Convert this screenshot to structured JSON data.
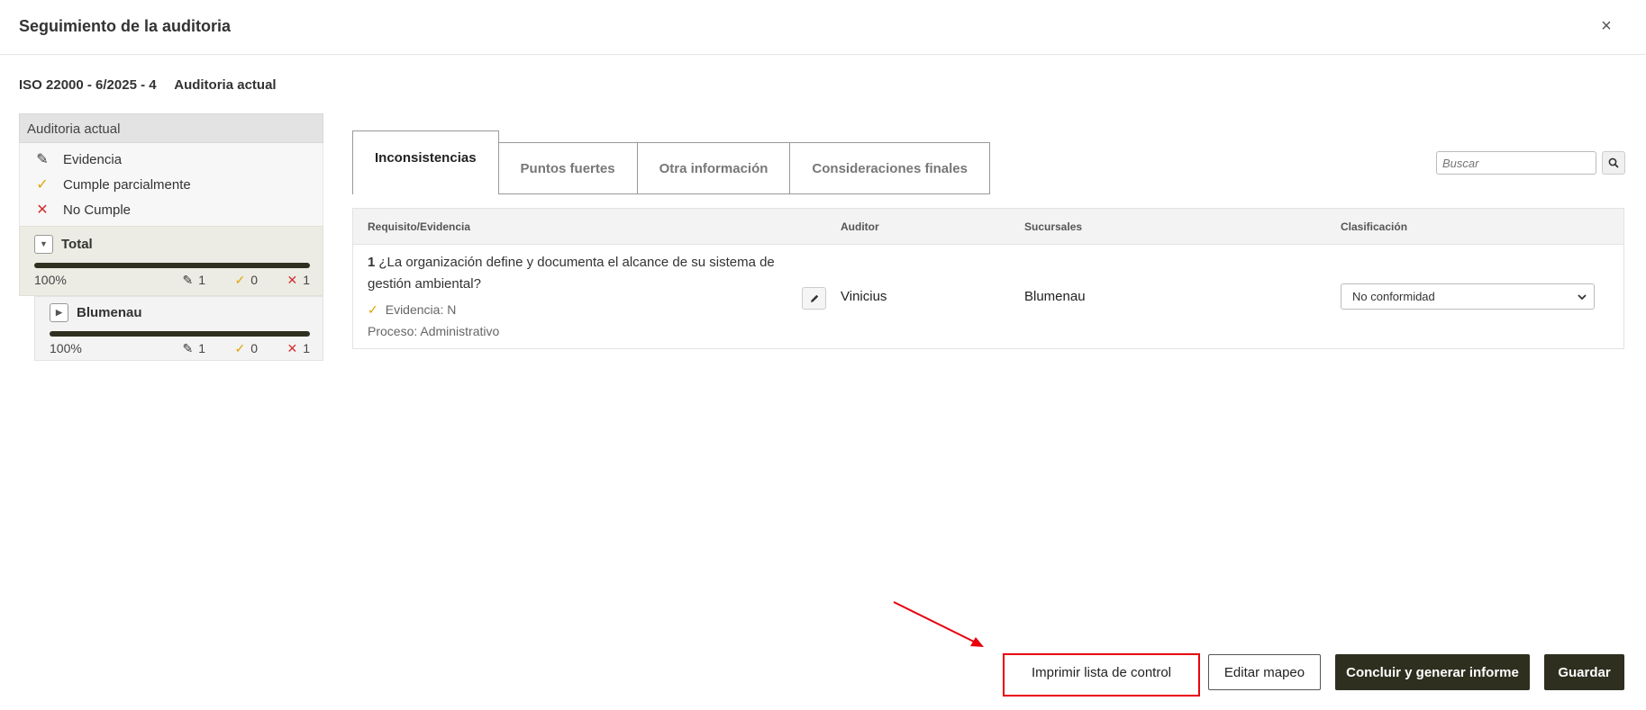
{
  "modal": {
    "title": "Seguimiento de la auditoria",
    "close_label": "×"
  },
  "subheader": {
    "audit_code": "ISO 22000 - 6/2025 - 4",
    "audit_label": "Auditoria actual"
  },
  "left_panel": {
    "title": "Auditoria actual",
    "legend": [
      {
        "label": "Evidencia",
        "icon": "pencil-icon"
      },
      {
        "label": "Cumple parcialmente",
        "icon": "check-icon"
      },
      {
        "label": "No Cumple",
        "icon": "x-icon"
      }
    ],
    "total": {
      "label": "Total",
      "progress": 1.0,
      "percent": "100%",
      "evidence": "1",
      "partial": "0",
      "fail": "1"
    },
    "branch": {
      "label": "Blumenau",
      "progress": 1.0,
      "percent": "100%",
      "evidence": "1",
      "partial": "0",
      "fail": "1"
    }
  },
  "tabs": [
    {
      "label": "Inconsistencias",
      "active": true
    },
    {
      "label": "Puntos fuertes",
      "active": false
    },
    {
      "label": "Otra información",
      "active": false
    },
    {
      "label": "Consideraciones finales",
      "active": false
    }
  ],
  "search": {
    "placeholder": "Buscar"
  },
  "table": {
    "headers": [
      "Requisito/Evidencia",
      "Auditor",
      "Sucursales",
      "Clasificación"
    ],
    "rows": [
      {
        "number": "1",
        "question": "¿La organización define y documenta el alcance de su sistema de gestión ambiental?",
        "evidence": "Evidencia: N",
        "process": "Proceso: Administrativo",
        "auditor": "Vinicius",
        "branch": "Blumenau",
        "classification": "No conformidad"
      }
    ]
  },
  "footer": {
    "print_label": "Imprimir lista de control",
    "edit_map_label": "Editar mapeo",
    "conclude_label": "Concluir y generar informe",
    "save_label": "Guardar"
  },
  "colors": {
    "dark_button": "#2e2f1f",
    "highlight": "#e8000b",
    "check": "#e0a500",
    "fail": "#d32f2f"
  }
}
